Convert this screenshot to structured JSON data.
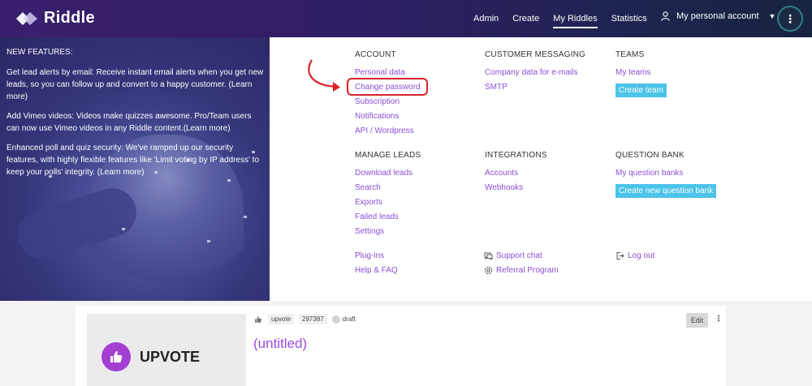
{
  "header": {
    "logo_text": "Riddle",
    "nav": [
      "Admin",
      "Create",
      "My Riddles",
      "Statistics"
    ],
    "active_nav": "My Riddles",
    "account_label": "My personal account",
    "more_label": "⋮"
  },
  "promo": {
    "title": "NEW FEATURES:",
    "items": [
      "Get lead alerts by email: Receive instant email alerts when you get new leads, so you can follow up and convert to a happy customer. (Learn more)",
      "Add Vimeo videos: Videos make quizzes awesome. Pro/Team users can now use Vimeo videos in any Riddle content.(Learn more)",
      "Enhanced poll and quiz security: We've ramped up our security features, with highly flexible features like 'Limit voting by IP address' to keep your polls' integrity. (Learn more)"
    ]
  },
  "menu": {
    "account": {
      "title": "ACCOUNT",
      "links": [
        "Personal data",
        "Change password",
        "Subscription",
        "Notifications",
        "API / Wordpress"
      ]
    },
    "customer_messaging": {
      "title": "CUSTOMER MESSAGING",
      "links": [
        "Company data for e-mails",
        "SMTP"
      ]
    },
    "teams": {
      "title": "TEAMS",
      "links": [
        "My teams"
      ],
      "button": "Create team"
    },
    "manage_leads": {
      "title": "MANAGE LEADS",
      "links": [
        "Download leads",
        "Search",
        "Exports",
        "Failed leads",
        "Settings"
      ]
    },
    "integrations": {
      "title": "INTEGRATIONS",
      "links": [
        "Accounts",
        "Webhooks"
      ]
    },
    "question_bank": {
      "title": "QUESTION BANK",
      "links": [
        "My question banks"
      ],
      "button": "Create new question bank"
    },
    "bottom": {
      "plugins": "Plug-ins",
      "help": "Help & FAQ",
      "support": "Support chat",
      "referral": "Referral Program",
      "logout": "Log out"
    }
  },
  "card": {
    "type_tag": "upvote",
    "id": "297387",
    "status": "draft",
    "title": "(untitled)",
    "thumb_label": "UPVOTE",
    "edit_label": "Edit",
    "more_label": "⋮"
  },
  "colors": {
    "link": "#8a4fd6",
    "button": "#4cc3e9",
    "highlight": "#d8232a",
    "upvote": "#a33fd1"
  }
}
